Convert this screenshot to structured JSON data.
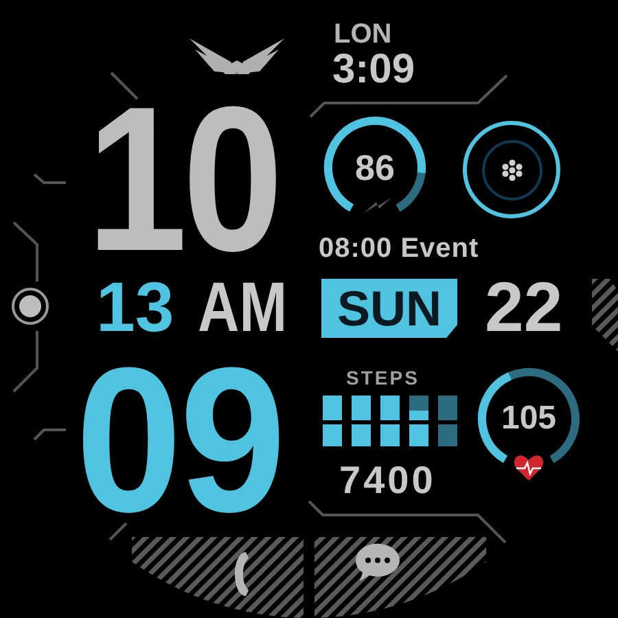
{
  "world_clock": {
    "city": "LON",
    "time": "3:09"
  },
  "time": {
    "hour": "10",
    "second": "13",
    "ampm": "AM",
    "minute": "09"
  },
  "battery": {
    "value": "86"
  },
  "event": "08:00 Event",
  "date": {
    "weekday": "SUN",
    "day": "22"
  },
  "steps": {
    "label": "STEPS",
    "value": "7400"
  },
  "heart_rate": {
    "value": "105"
  },
  "shortcuts": [
    {
      "kind": "phone"
    },
    {
      "kind": "messages"
    }
  ]
}
